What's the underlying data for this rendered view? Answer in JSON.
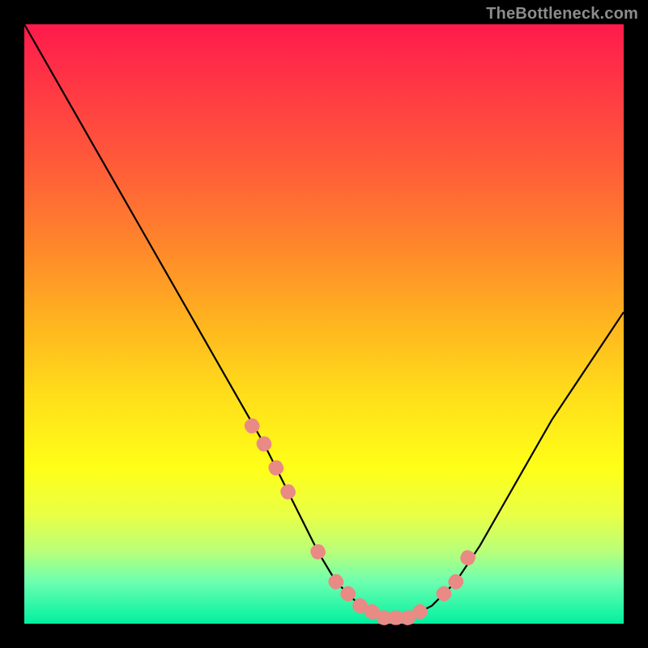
{
  "watermark": "TheBottleneck.com",
  "chart_data": {
    "type": "line",
    "title": "",
    "xlabel": "",
    "ylabel": "",
    "xlim": [
      0,
      100
    ],
    "ylim": [
      0,
      100
    ],
    "series": [
      {
        "name": "main-curve",
        "x": [
          0,
          4,
          8,
          12,
          16,
          20,
          24,
          28,
          32,
          36,
          40,
          43,
          46,
          49,
          52,
          55,
          58,
          62,
          64,
          68,
          72,
          76,
          80,
          84,
          88,
          92,
          96,
          100
        ],
        "y": [
          100,
          93,
          86,
          79,
          72,
          65,
          58,
          51,
          44,
          37,
          30,
          24,
          18,
          12,
          7,
          4,
          2,
          1,
          1,
          3,
          7,
          13,
          20,
          27,
          34,
          40,
          46,
          52
        ]
      },
      {
        "name": "dot-overlay",
        "x": [
          38,
          40,
          42,
          44,
          49,
          52,
          54,
          56,
          58,
          60,
          62,
          64,
          66,
          70,
          72,
          74
        ],
        "y": [
          33,
          30,
          26,
          22,
          12,
          7,
          5,
          3,
          2,
          1,
          1,
          1,
          2,
          5,
          7,
          11
        ]
      }
    ],
    "colors": {
      "curve": "#000000",
      "dots": "#e98a84",
      "gradient_top": "#ff1a4c",
      "gradient_mid": "#ffde1a",
      "gradient_bottom": "#00f0a0",
      "frame": "#000000"
    }
  }
}
